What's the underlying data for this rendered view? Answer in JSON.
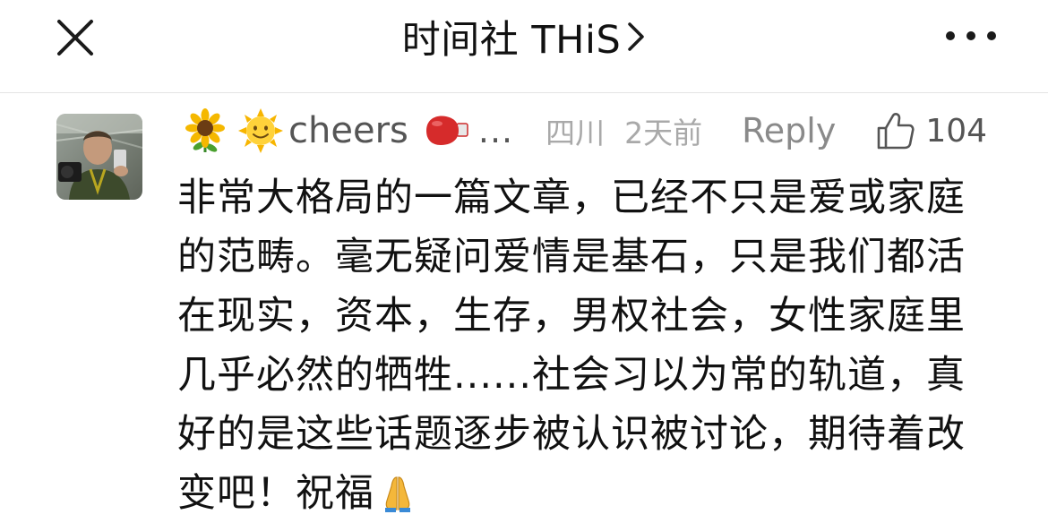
{
  "header": {
    "title": "时间社 THiS",
    "close_icon": "close-icon",
    "chevron_icon": "chevron-right-icon",
    "more_icon": "more-horizontal-icon"
  },
  "comment": {
    "avatar_icon": "user-avatar",
    "username_emojis": [
      "sunflower",
      "sun-with-face",
      "boxing-glove"
    ],
    "username": "cheers",
    "username_ellipsis": "...",
    "location": "四川",
    "time": "2天前",
    "reply_label": "Reply",
    "like_icon": "thumbs-up-icon",
    "like_count": "104",
    "text": "非常大格局的一篇文章，已经不只是爱或家庭的范畴。毫无疑问爱情是基石，只是我们都活在现实，资本，生存，男权社会，女性家庭里几乎必然的牺牲......社会习以为常的轨道，真好的是这些话题逐步被认识被讨论，期待着改变吧！祝福",
    "trailing_emoji": "folded-hands"
  },
  "colors": {
    "text_primary": "#111111",
    "text_secondary": "#555555",
    "text_muted": "#a9a9a9",
    "divider": "#e4e4e4"
  }
}
